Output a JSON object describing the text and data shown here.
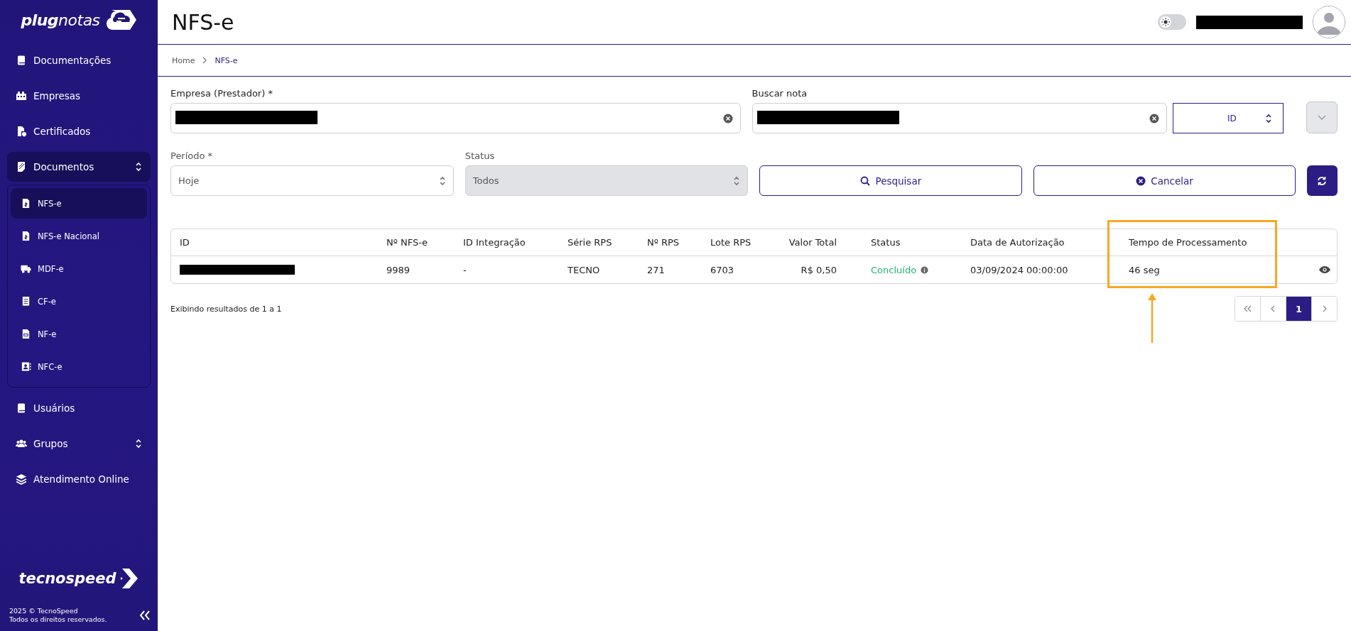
{
  "sidebar": {
    "logo": "**plug**notas",
    "items": [
      {
        "label": "Documentações",
        "selected": false,
        "kind": "link"
      },
      {
        "label": "Empresas",
        "selected": false,
        "kind": "link"
      },
      {
        "label": "Certificados",
        "selected": false,
        "kind": "link"
      },
      {
        "label": "Documentos",
        "selected": true,
        "kind": "group",
        "expanded": true,
        "children": [
          {
            "label": "NFS-e",
            "selected": true
          },
          {
            "label": "NFS-e Nacional",
            "selected": false
          },
          {
            "label": "MDF-e",
            "selected": false
          },
          {
            "label": "CF-e",
            "selected": false
          },
          {
            "label": "NF-e",
            "selected": false
          },
          {
            "label": "NFC-e",
            "selected": false
          }
        ]
      },
      {
        "label": "Usuários",
        "selected": false,
        "kind": "link"
      },
      {
        "label": "Grupos",
        "selected": false,
        "kind": "group"
      },
      {
        "label": "Atendimento Online",
        "selected": false,
        "kind": "link"
      }
    ],
    "footer_logo": "tecnospeed",
    "copyright": [
      "2025 © TecnoSpeed",
      "Todos os direitos reservados."
    ]
  },
  "header": {
    "title": "NFS-e",
    "dark_mode": false
  },
  "breadcrumb": [
    {
      "label": "Home",
      "selected": false
    },
    {
      "label": "NFS-e",
      "selected": true
    }
  ],
  "filters": {
    "empresa": {
      "label": "Empresa (Prestador) *"
    },
    "buscar": {
      "label": "Buscar nota",
      "search_type": "ID"
    },
    "periodo": {
      "label": "Período *",
      "value": "Hoje",
      "disabled": false
    },
    "status": {
      "label": "Status",
      "value": "Todos",
      "disabled": true
    },
    "buttons": [
      "Pesquisar",
      "Cancelar"
    ]
  },
  "table": {
    "columns": [
      {
        "label": "ID",
        "highlighted": false
      },
      {
        "label": "Nº NFS-e",
        "highlighted": false
      },
      {
        "label": "ID Integração",
        "highlighted": false
      },
      {
        "label": "Série RPS",
        "highlighted": false
      },
      {
        "label": "Nº RPS",
        "highlighted": false
      },
      {
        "label": "Lote RPS",
        "highlighted": false
      },
      {
        "label": "Valor Total",
        "highlighted": false
      },
      {
        "label": "Status",
        "highlighted": false
      },
      {
        "label": "Data de Autorização",
        "highlighted": false
      },
      {
        "label": "Tempo de Processamento",
        "highlighted": true
      }
    ],
    "rows": [
      {
        "nfse": "9989",
        "integracao": "-",
        "serie": "TECNO",
        "rps": "271",
        "lote": "6703",
        "valor": "R$ 0,50",
        "status": "Concluído",
        "color": "#22b573",
        "data": "03/09/2024 00:00:00",
        "tempo": "46 seg"
      }
    ]
  },
  "results_text": "Exibindo resultados de 1 a 1",
  "pagination": [
    {
      "label": "1",
      "selected": true
    }
  ]
}
